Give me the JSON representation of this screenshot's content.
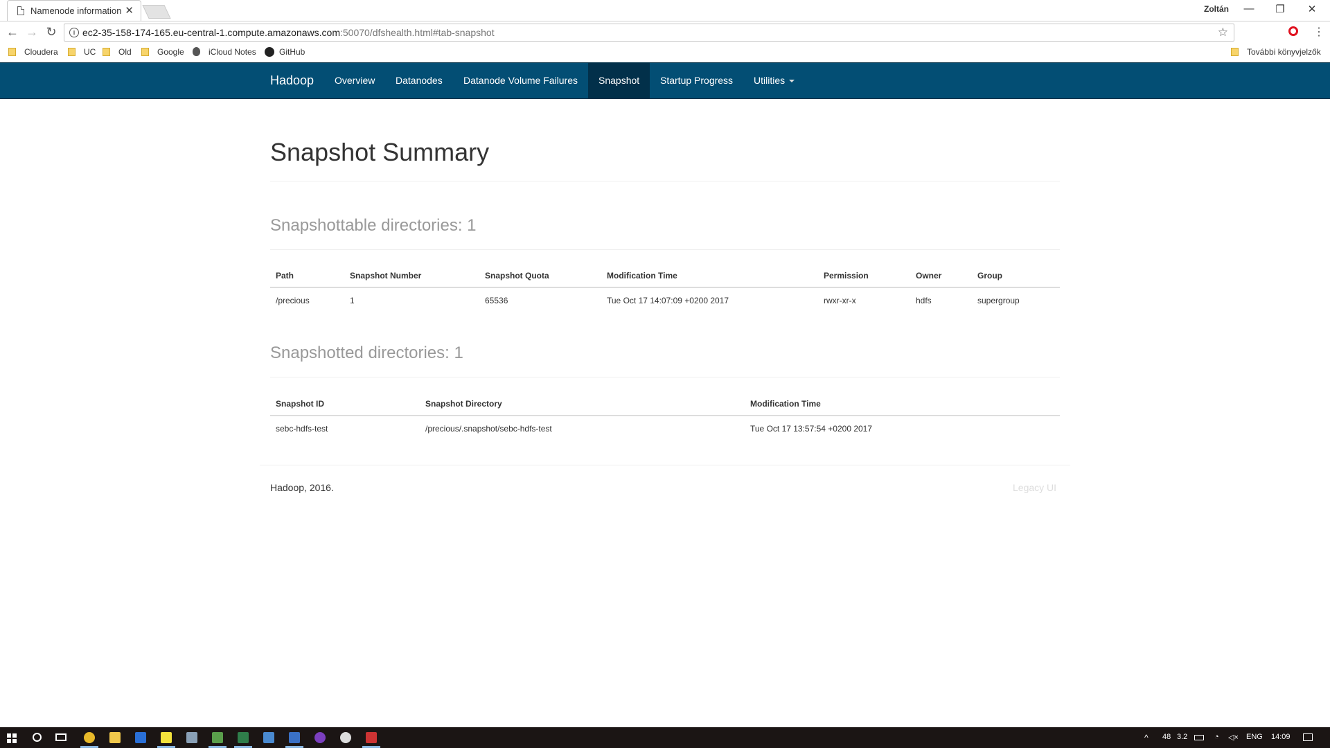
{
  "browser": {
    "tab_title": "Namenode information",
    "tab_close": "✕",
    "profile_name": "Zoltán",
    "url_host": "ec2-35-158-174-165.eu-central-1.compute.amazonaws.com",
    "url_path": ":50070/dfshealth.html#tab-snapshot",
    "bookmarks": [
      "Cloudera",
      "UC",
      "Old",
      "Google",
      "iCloud Notes",
      "GitHub"
    ],
    "other_bookmarks": "További könyvjelzők",
    "back_glyph": "←",
    "forward_glyph": "→",
    "reload_glyph": "↻",
    "star_glyph": "☆",
    "menu_glyph": "⋮",
    "minimize_glyph": "—",
    "restore_glyph": "❐",
    "close_glyph": "✕"
  },
  "nav": {
    "brand": "Hadoop",
    "items": [
      "Overview",
      "Datanodes",
      "Datanode Volume Failures",
      "Snapshot",
      "Startup Progress",
      "Utilities"
    ],
    "active": "Snapshot",
    "colors": {
      "bar": "#034e74",
      "active": "#02304a"
    }
  },
  "page": {
    "title": "Snapshot Summary",
    "snapshottable": {
      "heading": "Snapshottable directories: 1",
      "columns": [
        "Path",
        "Snapshot Number",
        "Snapshot Quota",
        "Modification Time",
        "Permission",
        "Owner",
        "Group"
      ],
      "rows": [
        [
          "/precious",
          "1",
          "65536",
          "Tue Oct 17 14:07:09 +0200 2017",
          "rwxr-xr-x",
          "hdfs",
          "supergroup"
        ]
      ]
    },
    "snapshotted": {
      "heading": "Snapshotted directories: 1",
      "columns": [
        "Snapshot ID",
        "Snapshot Directory",
        "Modification Time"
      ],
      "rows": [
        [
          "sebc-hdfs-test",
          "/precious/.snapshot/sebc-hdfs-test",
          "Tue Oct 17 13:57:54 +0200 2017"
        ]
      ]
    }
  },
  "footer": {
    "left": "Hadoop, 2016.",
    "right": "Legacy UI"
  },
  "taskbar": {
    "tray": {
      "a": "48",
      "b": "3.2",
      "lang": "ENG",
      "time": "14:09"
    }
  }
}
